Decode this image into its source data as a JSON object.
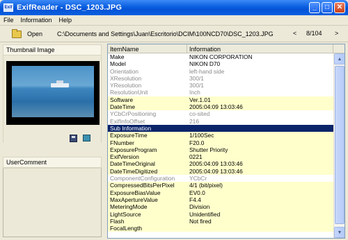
{
  "window": {
    "title": "ExifReader - DSC_1203.JPG",
    "app_icon_text": "Exif"
  },
  "window_buttons": {
    "minimize": "_",
    "maximize": "□",
    "close": "✕"
  },
  "menu": [
    {
      "label": "File",
      "mnemonic": "F"
    },
    {
      "label": "Information",
      "mnemonic": "I"
    },
    {
      "label": "Help",
      "mnemonic": "H"
    }
  ],
  "toolbar": {
    "open_label": "Open",
    "path": "C:\\Documents and Settings\\Juan\\Escritorio\\DCIM\\100NCD70\\DSC_1203.JPG",
    "prev_symbol": "<",
    "next_symbol": ">",
    "counter": "8/104"
  },
  "left": {
    "thumbnail_header": "Thumbnail Image",
    "comment_header": "UserComment",
    "comment_value": ""
  },
  "table": {
    "headers": [
      "ItemName",
      "Information"
    ],
    "rows": [
      {
        "name": "Make",
        "value": "NIKON CORPORATION",
        "style": "white"
      },
      {
        "name": "Model",
        "value": "NIKON D70",
        "style": "white"
      },
      {
        "name": "Orientation",
        "value": "left-hand side",
        "style": "dim"
      },
      {
        "name": "XResolution",
        "value": "300/1",
        "style": "dim"
      },
      {
        "name": "YResolution",
        "value": "300/1",
        "style": "dim"
      },
      {
        "name": "ResolutionUnit",
        "value": "Inch",
        "style": "dim"
      },
      {
        "name": "Software",
        "value": "Ver.1.01",
        "style": "yellow"
      },
      {
        "name": "DateTime",
        "value": "2005:04:09 13:03:46",
        "style": "yellow"
      },
      {
        "name": "YCbCrPositioning",
        "value": "co-sited",
        "style": "dim"
      },
      {
        "name": "ExifInfoOffset",
        "value": "216",
        "style": "dim"
      },
      {
        "name": "Sub Information",
        "value": "",
        "style": "section"
      },
      {
        "name": "ExposureTime",
        "value": "1/100Sec",
        "style": "yellow"
      },
      {
        "name": "FNumber",
        "value": "F20.0",
        "style": "yellow"
      },
      {
        "name": "ExposureProgram",
        "value": "Shutter Priority",
        "style": "yellow"
      },
      {
        "name": "ExifVersion",
        "value": "0221",
        "style": "yellow"
      },
      {
        "name": "DateTimeOriginal",
        "value": "2005:04:09 13:03:46",
        "style": "yellow"
      },
      {
        "name": "DateTimeDigitized",
        "value": "2005:04:09 13:03:46",
        "style": "yellow"
      },
      {
        "name": "ComponentConfiguration",
        "value": "YCbCr",
        "style": "dim"
      },
      {
        "name": "CompressedBitsPerPixel",
        "value": "4/1 (bit/pixel)",
        "style": "yellow"
      },
      {
        "name": "ExposureBiasValue",
        "value": "EV0.0",
        "style": "yellow"
      },
      {
        "name": "MaxApertureValue",
        "value": "F4.4",
        "style": "yellow"
      },
      {
        "name": "MeteringMode",
        "value": "Division",
        "style": "yellow"
      },
      {
        "name": "LightSource",
        "value": "Unidentified",
        "style": "yellow"
      },
      {
        "name": "Flash",
        "value": "Not fired",
        "style": "yellow"
      },
      {
        "name": "FocalLength",
        "value": "",
        "style": "yellow"
      }
    ]
  },
  "colors": {
    "titlebar": "#0a5fe0",
    "selected_row": "#0a246a",
    "yellow_row": "#ffffcc"
  }
}
